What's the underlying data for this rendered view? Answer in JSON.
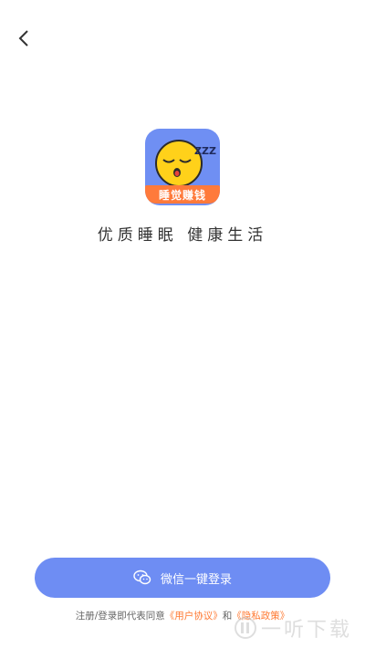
{
  "header": {
    "back_icon": "chevron-left-icon"
  },
  "logo": {
    "banner_text": "睡觉赚钱",
    "badge_text": "ZZZ",
    "colors": {
      "bg": "#6f8ff3",
      "face": "#ffd11a",
      "banner": "#ff7a3b"
    }
  },
  "slogan": "优质睡眠  健康生活",
  "login_button": {
    "icon": "wechat-icon",
    "label": "微信一键登录",
    "color": "#6e8df3"
  },
  "agreement": {
    "prefix": "注册/登录即代表同意",
    "user_agreement": "《用户协议》",
    "conjunction": "和",
    "privacy_policy": "《隐私政策》"
  },
  "watermark": {
    "text": "一听下载"
  }
}
